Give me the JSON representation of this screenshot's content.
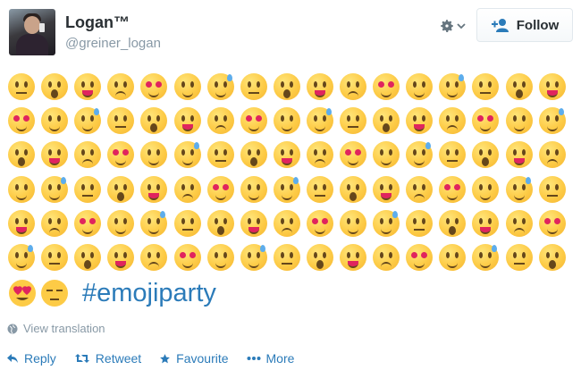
{
  "user": {
    "name": "Logan™",
    "handle": "@greiner_logan"
  },
  "header": {
    "follow_label": "Follow"
  },
  "tweet": {
    "hashtag": "#emojiparty"
  },
  "translate": {
    "label": "View translation"
  },
  "actions": {
    "reply": "Reply",
    "retweet": "Retweet",
    "favourite": "Favourite",
    "more": "More"
  },
  "colors": {
    "link": "#2b7bb9",
    "muted": "#8899a6",
    "emoji_face": "#fdcb46"
  },
  "icons": [
    "gear-icon",
    "chevron-down-icon",
    "follow-person-icon",
    "globe-icon",
    "reply-icon",
    "retweet-icon",
    "star-icon",
    "more-dots-icon"
  ]
}
